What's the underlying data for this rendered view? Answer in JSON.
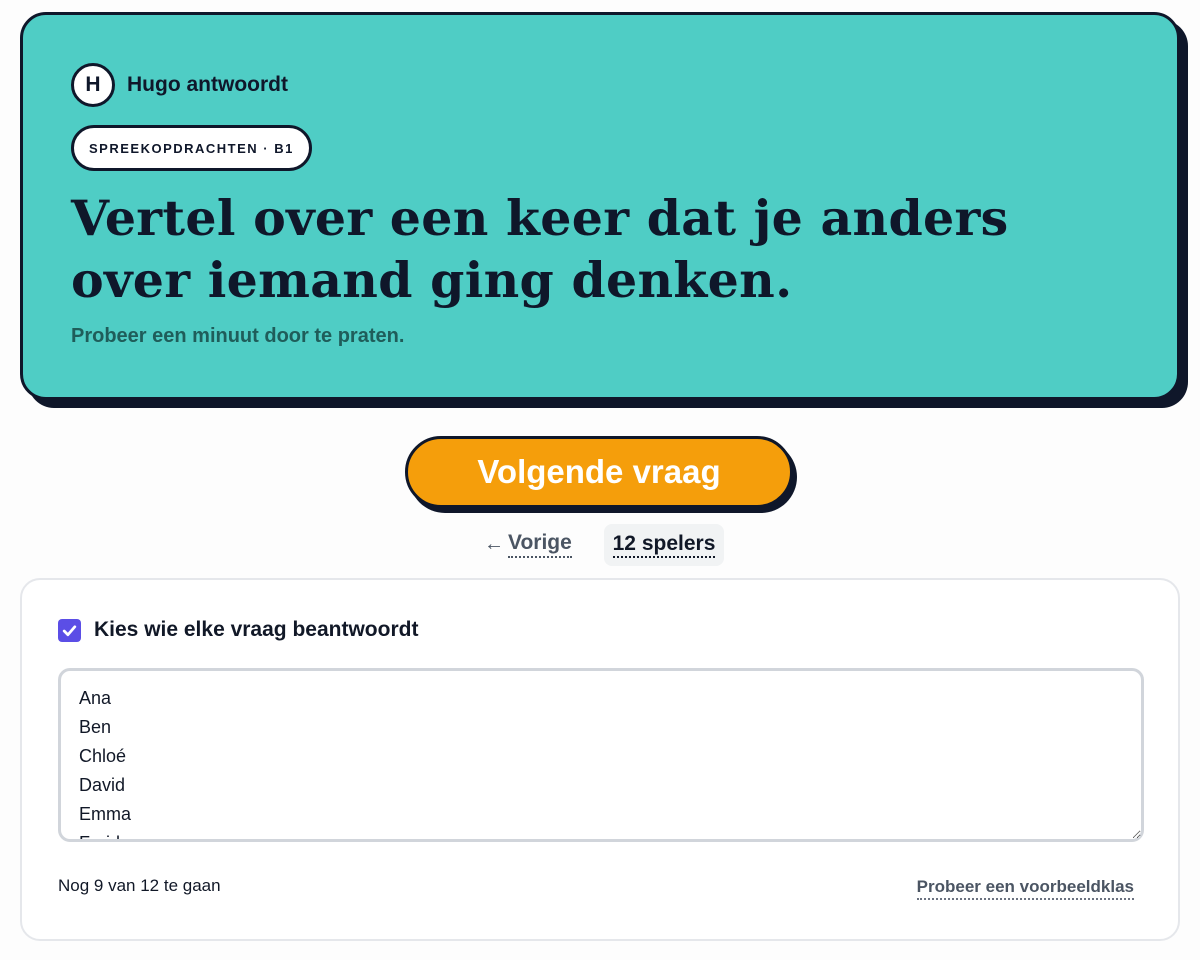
{
  "question_card": {
    "avatar_initial": "H",
    "answerer": "Hugo antwoordt",
    "category": "SPREEKOPDRACHTEN · B1",
    "question": "Vertel over een keer dat je anders over iemand ging denken.",
    "hint": "Probeer een minuut door te praten.",
    "bg_color": "#4fcdc5"
  },
  "controls": {
    "next_label": "Volgende vraag",
    "prev_label": "Vorige",
    "players_label": "12 spelers",
    "accent_color": "#f59e0b"
  },
  "players_panel": {
    "pick_label": "Kies wie elke vraag beantwoordt",
    "pick_checked": true,
    "names_value": "Ana\nBen\nChloé\nDavid\nEmma\nFarid",
    "remaining": "Nog 9 van 12 te gaan",
    "sample_link": "Probeer een voorbeeldklas"
  }
}
